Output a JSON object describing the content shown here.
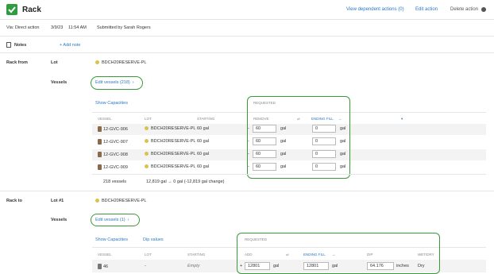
{
  "header": {
    "title": "Rack",
    "view_dependent": "View dependent actions (0)",
    "edit_action": "Edit action",
    "delete_action": "Delete action"
  },
  "meta": {
    "via": "Via: Direct action",
    "date": "3/9/23",
    "time": "11:54 AM",
    "submitted": "Submitted by Sarah Rogers"
  },
  "notes": {
    "label": "Notes",
    "add": "+ Add note"
  },
  "rack_from": {
    "label": "Rack from",
    "lot_label": "Lot",
    "lot_value": "BDCH20RESERVE-PL",
    "vessels_label": "Vessels",
    "edit_vessels": "Edit vessels (218)",
    "show_capacities": "Show Capacities",
    "requested": "REQUESTED",
    "columns": [
      "VESSEL",
      "LOT",
      "STARTING",
      "REMOVE",
      "ENDING FILL"
    ],
    "rows": [
      {
        "vessel": "12-GVC-906",
        "lot": "BDCH20RESERVE-PL",
        "starting": "60 gal",
        "remove": "60",
        "ending": "0"
      },
      {
        "vessel": "12-GVC-907",
        "lot": "BDCH20RESERVE-PL",
        "starting": "60 gal",
        "remove": "60",
        "ending": "0"
      },
      {
        "vessel": "12-GVC-908",
        "lot": "BDCH20RESERVE-PL",
        "starting": "60 gal",
        "remove": "60",
        "ending": "0"
      },
      {
        "vessel": "12-GVC-909",
        "lot": "BDCH20RESERVE-PL",
        "starting": "60 gal",
        "remove": "60",
        "ending": "0"
      }
    ],
    "unit": "gal",
    "summary_count": "218 vessels",
    "summary_change": "12,819 gal → 0 gal (-12,819 gal change)"
  },
  "rack_to": {
    "label": "Rack to",
    "lot_label": "Lot #1",
    "lot_value": "BDCH20RESERVE-PL",
    "vessels_label": "Vessels",
    "edit_vessels": "Edit vessels (1)",
    "show_capacities": "Show Capacities",
    "dip_values": "Dip values",
    "requested": "REQUESTED",
    "columns": [
      "VESSEL",
      "LOT",
      "STARTING",
      "ADD",
      "ENDING FILL",
      "DIP",
      "WET/DRY"
    ],
    "row": {
      "vessel": "46",
      "lot": "-",
      "starting": "Empty",
      "add": "12801",
      "ending": "12801",
      "dip": "64.176",
      "dip_unit": "inches",
      "wetdry": "Dry"
    },
    "unit": "gal"
  },
  "colors": {
    "accent": "#2e9c3f",
    "link": "#2b78c5",
    "callout": "#3a9a3a"
  }
}
